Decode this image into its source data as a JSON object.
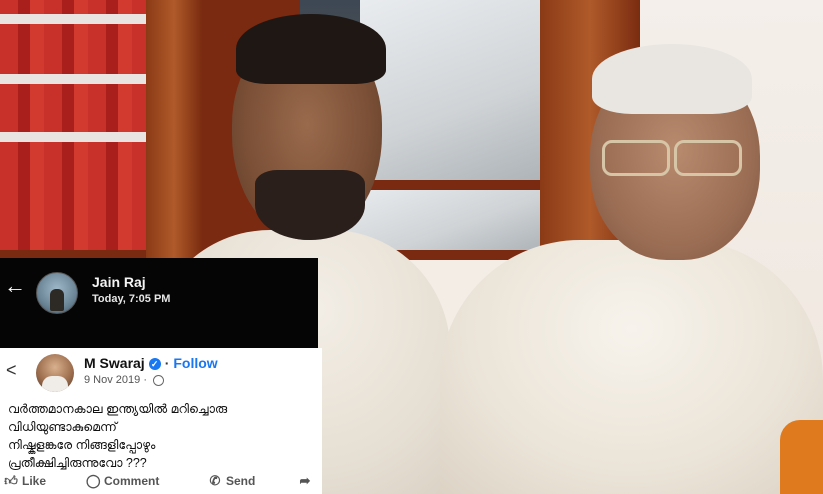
{
  "top_bar": {
    "back_icon": "arrow-left-icon",
    "name": "Jain Raj",
    "time": "Today, 7:05 PM"
  },
  "post": {
    "back_icon": "chevron-left-icon",
    "author": "M Swaraj",
    "verified_icon": "verified-badge-icon",
    "separator": "·",
    "follow_label": "Follow",
    "date": "9 Nov 2019 · ",
    "audience_icon": "globe-icon",
    "text": "വർത്തമാനകാല ഇന്ത്യയിൽ മറിച്ചൊരു\nവിധിയുണ്ടാകുമെന്ന്\nനിഷ്കളങ്കരേ നിങ്ങളിപ്പോഴും\nപ്രതീക്ഷിച്ചിരുന്നുവോ ???"
  },
  "actions": {
    "like_label": "Like",
    "comment_label": "Comment",
    "send_label": "Send",
    "share_icon": "share-arrow-icon"
  },
  "colors": {
    "facebook_blue": "#1877f2",
    "dark_header": "#050505"
  }
}
